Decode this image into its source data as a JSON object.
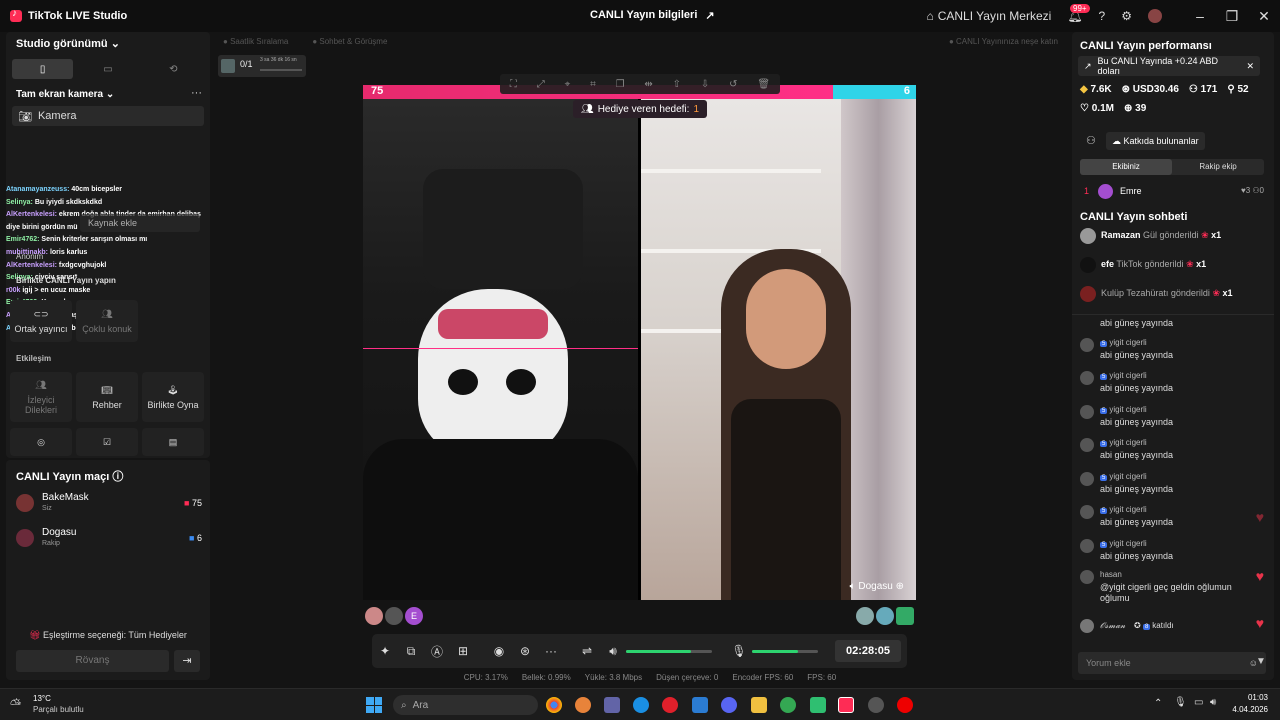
{
  "titlebar": {
    "app_name": "TikTok LIVE Studio",
    "center_title": "CANLI Yayın bilgileri",
    "live_center": "CANLI Yayın Merkezi",
    "notif_count": "99+"
  },
  "left": {
    "studio_view": "Studio görünümü",
    "fullscreen_camera": "Tam ekran kamera",
    "camera": "Kamera",
    "add_source": "Kaynak ekle",
    "anonim": "Anonim",
    "together_live": "Birlikte CANLI Yayın yapın",
    "cohost": "Ortak yayıncı",
    "multi_guest": "Çoklu konuk",
    "interaction": "Etkileşim",
    "viewer_requests": "İzleyici Dilekleri",
    "guide": "Rehber",
    "play_together": "Birlikte Oyna",
    "chat_overlay": [
      {
        "user": "Atanamayanzeuss:",
        "text": "40cm biceps",
        "tail": "ler"
      },
      {
        "user": "Selinya:",
        "text": "Bu iyiydi skdkskdkd",
        "tail": ""
      },
      {
        "user": "AlKertenkelesi:",
        "text": "ekrem doğa abla tinder da emirhan delibaş diye birini gördün mü",
        "tail": ""
      },
      {
        "user": "Emir4762:",
        "text": "Senin kriterler sarışın olması mı",
        "tail": ""
      },
      {
        "user": "muhittinakb:",
        "text": "loris karlus",
        "tail": ""
      },
      {
        "user": "AlKertenkelesi:",
        "text": "fxdgcvghujokl",
        "tail": ""
      },
      {
        "user": "Selinya:",
        "text": "civciv sarısı*",
        "tail": ""
      },
      {
        "user": "r00k",
        "text": "igij > en ucuz maske",
        "tail": ""
      },
      {
        "user": "Emir4762:",
        "text": "Kumral",
        "tail": ""
      },
      {
        "user": "AlKertenkelesi:",
        "text": "Alt aşırı",
        "tail": ""
      },
      {
        "user": "Atanamayanzeuss:",
        "text": "bende mersin",
        "tail": ""
      }
    ]
  },
  "match": {
    "title": "CANLI Yayın maçı",
    "players": [
      {
        "name": "BakeMask",
        "role": "Siz",
        "score": "75"
      },
      {
        "name": "Dogasu",
        "role": "Rakip",
        "score": "6"
      }
    ],
    "pairing": "Eşleştirme seçeneği: Tüm Hediyeler",
    "rematch": "Rövanş"
  },
  "top": {
    "weekly_rank": "Saatlik Sıralama",
    "chat_talk": "Sohbet & Görüşme",
    "hint": "CANLI Yayınınıza neşe katın",
    "progress": "0/1",
    "progress_time": "3 sa 36 dk 16 sn"
  },
  "stage": {
    "left_score": "75",
    "right_score": "6",
    "gift_target": "Hediye veren hedefi:",
    "gift_target_value": "1",
    "opponent": "Dogasu"
  },
  "controls": {
    "timer": "02:28:05",
    "volume_level": 0.75,
    "mic_level": 0.7
  },
  "stats": {
    "cpu": "CPU: 3.17%",
    "memory": "Bellek: 0.99%",
    "upload": "Yükle: 3.8 Mbps",
    "dropped": "Düşen çerçeve: 0",
    "encoder_fps": "Encoder FPS: 60",
    "fps": "FPS: 60"
  },
  "right": {
    "perf_title": "CANLI Yayın performansı",
    "banner": "Bu CANLI Yayında +0.24 ABD doları",
    "diamonds": "7.6K",
    "usd": "USD30.46",
    "viewers": "171",
    "followers": "52",
    "likes": "0.1M",
    "shares": "39",
    "contributors": "Katkıda bulunanlar",
    "tab_team": "Ekibiniz",
    "tab_rival": "Rakip ekip",
    "top_contributor": {
      "rank": "1",
      "name": "Emre",
      "likes": "3",
      "gifts": "0"
    },
    "chat_title": "CANLI Yayın sohbeti",
    "gifts": [
      {
        "user": "Ramazan",
        "action": "Gül gönderildi",
        "count": "x1"
      },
      {
        "user": "efe",
        "action": "TikTok gönderildi",
        "count": "x1"
      },
      {
        "user": "",
        "action": "Kulüp Tezahüratı gönderildi",
        "count": "x1"
      }
    ],
    "messages": [
      {
        "name": "",
        "text": "abi güneş yayında",
        "lvl": ""
      },
      {
        "name": "yigit cigerli",
        "text": "abi güneş yayında",
        "lvl": "5"
      },
      {
        "name": "yigit cigerli",
        "text": "abi güneş yayında",
        "lvl": "5"
      },
      {
        "name": "yigit cigerli",
        "text": "abi güneş yayında",
        "lvl": "5"
      },
      {
        "name": "yigit cigerli",
        "text": "abi güneş yayında",
        "lvl": "5"
      },
      {
        "name": "yigit cigerli",
        "text": "abi güneş yayında",
        "lvl": "5"
      },
      {
        "name": "yigit cigerli",
        "text": "abi güneş yayında",
        "lvl": "5"
      },
      {
        "name": "yigit cigerli",
        "text": "abi güneş yayında",
        "lvl": "5"
      },
      {
        "name": "hasan",
        "text": "@yigit cigerli geç geldin oğlumun oğlumu",
        "lvl": ""
      }
    ],
    "join": {
      "name": "𝓞𝓼𝓶𝓪𝓷",
      "lvl": "8",
      "text": "katıldı"
    },
    "comment_placeholder": "Yorum ekle"
  },
  "taskbar": {
    "temp": "13°C",
    "weather": "Parçalı bulutlu",
    "search": "Ara",
    "time": "01:03",
    "date": "4.04.2026"
  }
}
